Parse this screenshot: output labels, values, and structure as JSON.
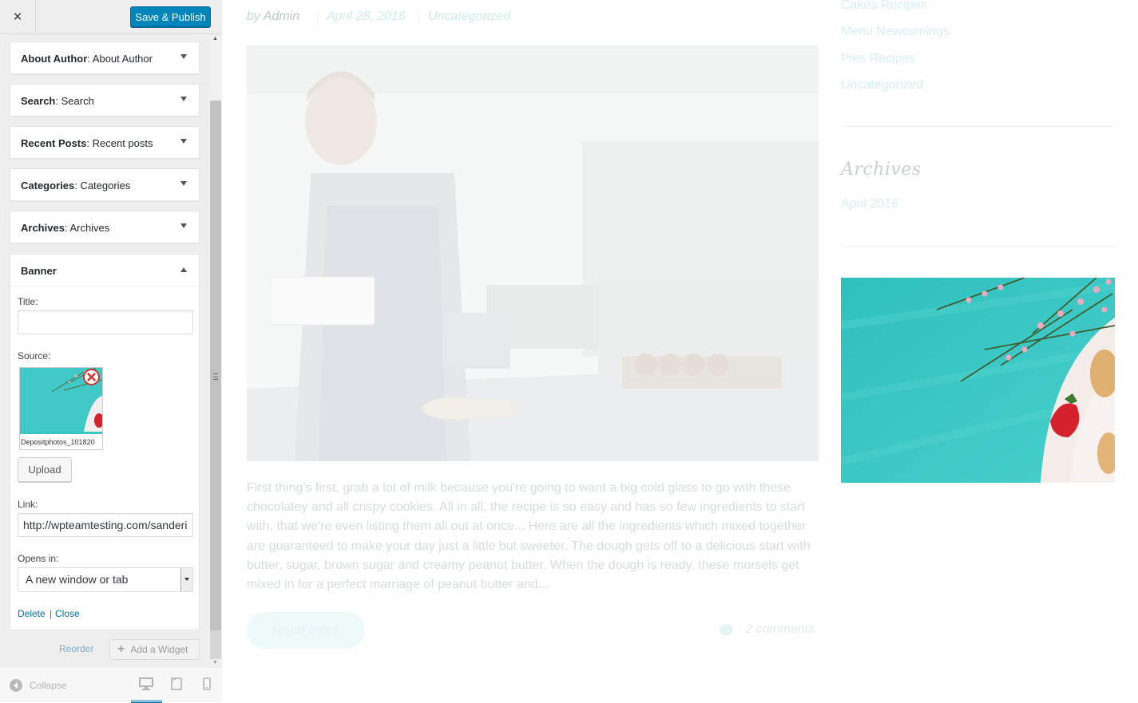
{
  "topbar": {
    "close_label": "×",
    "publish_label": "Save & Publish"
  },
  "widgets": [
    {
      "type": "About Author",
      "title": "About Author"
    },
    {
      "type": "Search",
      "title": "Search"
    },
    {
      "type": "Recent Posts",
      "title": "Recent posts"
    },
    {
      "type": "Categories",
      "title": "Categories"
    },
    {
      "type": "Archives",
      "title": "Archives"
    }
  ],
  "banner": {
    "heading": "Banner",
    "title_label": "Title:",
    "title_value": "",
    "source_label": "Source:",
    "image_filename": "Depositphotos_101820",
    "upload_label": "Upload",
    "link_label": "Link:",
    "link_value": "http://wpteamtesting.com/sanderi",
    "opens_label": "Opens in:",
    "opens_value": "A new window or tab",
    "delete_label": "Delete",
    "separator": "|",
    "close_label": "Close"
  },
  "actions": {
    "reorder_label": "Reorder",
    "add_widget_label": "Add a Widget"
  },
  "footer": {
    "collapse_label": "Collapse"
  },
  "preview": {
    "meta_by": "by",
    "meta_author": "Admin",
    "meta_date": "April 28, 2016",
    "meta_category": "Uncategorized",
    "excerpt": "First thing's first, grab a lot of milk because you're going to want a big cold glass to go with these chocolatey and all crispy cookies. All in all, the recipe is so easy and has so few ingredients to start with, that we're even listing them all out at once... Here are all the ingredients which mixed together are guaranteed to make your day just a little but sweeter. The dough gets off to a delicious start with butter, sugar, brown sugar and creamy peanut butter. When the dough is ready, these morsels get mixed in for a perfect marriage of peanut butter and...",
    "read_more_label": "Read more",
    "comments_label": "2 comments",
    "categories": [
      "Cakes Recipes",
      "Menu Newcomings",
      "Pies Recipes",
      "Uncategorized"
    ],
    "archives_title": "Archives",
    "archive_link": "April 2016"
  },
  "colors": {
    "accent": "#0085ba",
    "link": "#0073aa",
    "teal": "#3ac7c4"
  }
}
